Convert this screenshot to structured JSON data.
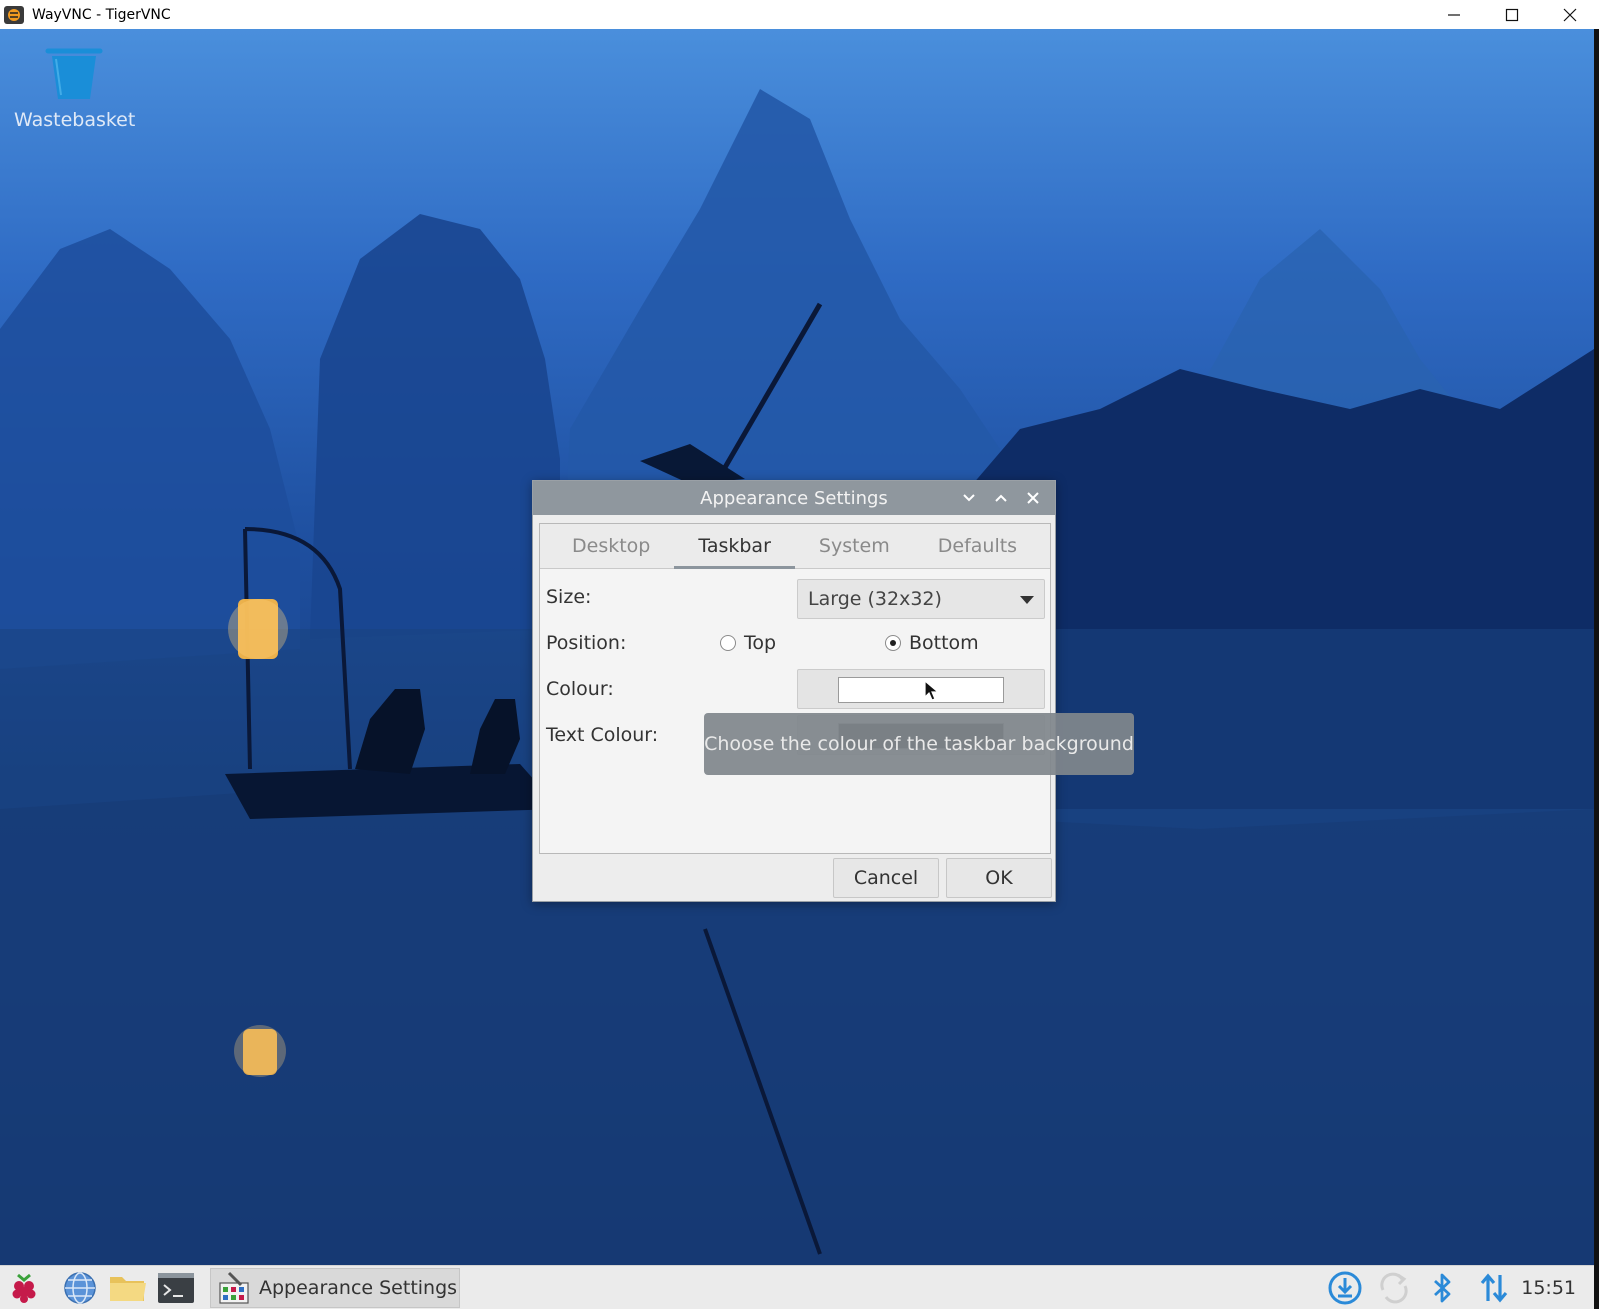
{
  "window": {
    "title": "WayVNC - TigerVNC",
    "app_icon": "tigervnc-icon",
    "controls": [
      "minimize-icon",
      "maximize-icon",
      "close-icon"
    ]
  },
  "desktop": {
    "icons": [
      {
        "label": "Wastebasket",
        "icon": "wastebasket-icon"
      }
    ]
  },
  "dialog": {
    "title": "Appearance Settings",
    "title_controls": [
      "chevron-down-icon",
      "chevron-up-icon",
      "close-icon"
    ],
    "tabs": [
      {
        "label": "Desktop",
        "active": false
      },
      {
        "label": "Taskbar",
        "active": true
      },
      {
        "label": "System",
        "active": false
      },
      {
        "label": "Defaults",
        "active": false
      }
    ],
    "size": {
      "label": "Size:",
      "value": "Large (32x32)"
    },
    "position": {
      "label": "Position:",
      "options": [
        {
          "label": "Top",
          "checked": false
        },
        {
          "label": "Bottom",
          "checked": true
        }
      ]
    },
    "colour": {
      "label": "Colour:",
      "swatch": "#ffffff"
    },
    "text_colour": {
      "label": "Text Colour:",
      "swatch": "#333333"
    },
    "tooltip": "Choose the colour of the taskbar background",
    "buttons": {
      "cancel": "Cancel",
      "ok": "OK"
    }
  },
  "taskbar": {
    "launchers": [
      "raspberry-menu-icon",
      "web-browser-icon",
      "file-manager-icon",
      "terminal-icon"
    ],
    "task": {
      "label": "Appearance Settings",
      "icon": "appearance-settings-icon"
    },
    "tray": [
      "download-updates-icon",
      "sync-icon",
      "bluetooth-icon",
      "network-icon"
    ],
    "clock": "15:51"
  }
}
